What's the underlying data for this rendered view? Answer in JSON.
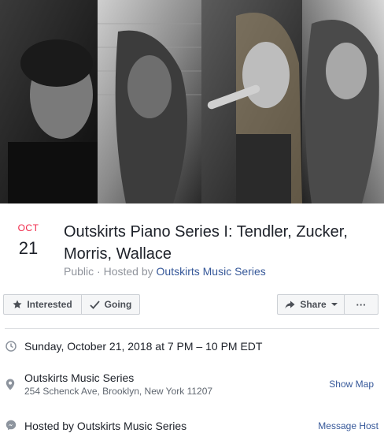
{
  "event": {
    "month": "OCT",
    "day": "21",
    "title": "Outskirts Piano Series I: Tendler, Zucker, Morris, Wallace",
    "privacy": "Public",
    "separator": " · ",
    "hosted_prefix": "Hosted by ",
    "host_name": "Outskirts Music Series"
  },
  "actions": {
    "interested": "Interested",
    "going": "Going",
    "share": "Share",
    "more": "···"
  },
  "details": {
    "datetime": "Sunday, October 21, 2018 at 7 PM – 10 PM EDT",
    "venue_name": "Outskirts Music Series",
    "venue_address": "254 Schenck Ave, Brooklyn, New York 11207",
    "show_map": "Show Map",
    "hosted_by": "Hosted by Outskirts Music Series",
    "message_host": "Message Host"
  },
  "colors": {
    "month_red": "#f02849",
    "link_blue": "#365899",
    "muted_gray": "#90949c",
    "icon_gray": "#8d949e"
  }
}
